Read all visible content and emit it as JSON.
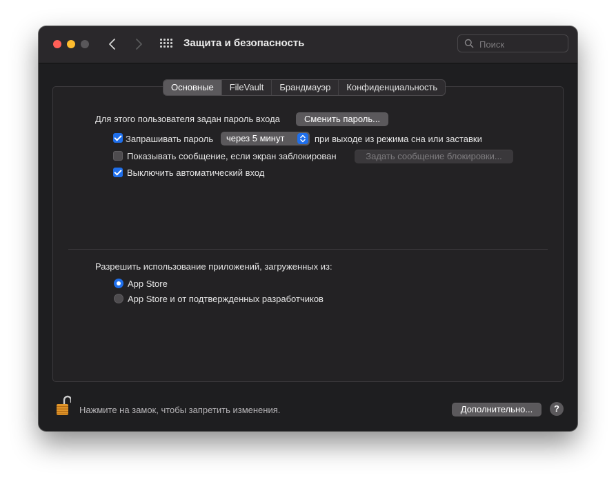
{
  "window": {
    "title": "Защита и безопасность",
    "search_placeholder": "Поиск"
  },
  "tabs": [
    {
      "label": "Основные",
      "active": true
    },
    {
      "label": "FileVault",
      "active": false
    },
    {
      "label": "Брандмауэр",
      "active": false
    },
    {
      "label": "Конфиденциальность",
      "active": false
    }
  ],
  "general": {
    "password_label": "Для этого пользователя задан пароль входа",
    "change_password_button": "Сменить пароль...",
    "require_password": {
      "label": "Запрашивать пароль",
      "checked": true,
      "delay_value": "через 5 минут",
      "suffix": "при выходе из режима сна или заставки"
    },
    "show_message": {
      "label": "Показывать сообщение, если экран заблокирован",
      "checked": false,
      "button": "Задать сообщение блокировки..."
    },
    "disable_auto_login": {
      "label": "Выключить автоматический вход",
      "checked": true
    }
  },
  "apps": {
    "heading": "Разрешить использование приложений, загруженных из:",
    "options": [
      {
        "label": "App Store",
        "selected": true
      },
      {
        "label": "App Store и от подтвержденных разработчиков",
        "selected": false
      }
    ]
  },
  "footer": {
    "lock_text": "Нажмите на замок, чтобы запретить изменения.",
    "advanced_button": "Дополнительно...",
    "help_label": "?"
  },
  "colors": {
    "accent": "#1f6feb",
    "window_bg": "#1e1e20"
  }
}
